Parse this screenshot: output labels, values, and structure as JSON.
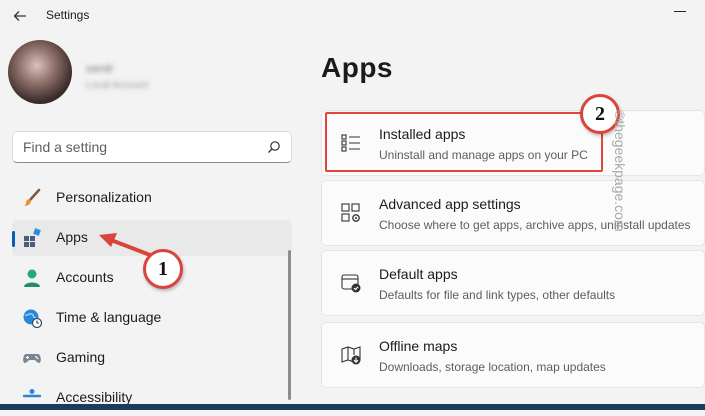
{
  "window": {
    "title": "Settings"
  },
  "profile": {
    "name": "sandr",
    "email": "Local Account"
  },
  "search": {
    "placeholder": "Find a setting"
  },
  "nav": {
    "items": [
      {
        "label": "Personalization",
        "selected": false
      },
      {
        "label": "Apps",
        "selected": true
      },
      {
        "label": "Accounts",
        "selected": false
      },
      {
        "label": "Time & language",
        "selected": false
      },
      {
        "label": "Gaming",
        "selected": false
      },
      {
        "label": "Accessibility",
        "selected": false
      }
    ]
  },
  "main": {
    "title": "Apps",
    "cards": [
      {
        "title": "Installed apps",
        "subtitle": "Uninstall and manage apps on your PC",
        "icon": "list-icon"
      },
      {
        "title": "Advanced app settings",
        "subtitle": "Choose where to get apps, archive apps, uninstall updates",
        "icon": "app-settings-icon"
      },
      {
        "title": "Default apps",
        "subtitle": "Defaults for file and link types, other defaults",
        "icon": "default-apps-icon"
      },
      {
        "title": "Offline maps",
        "subtitle": "Downloads, storage location, map updates",
        "icon": "map-icon"
      }
    ]
  },
  "annotations": {
    "step1": "1",
    "step2": "2",
    "watermark": "©thegeekpage.com"
  },
  "colors": {
    "accent": "#005fb8",
    "annotation": "#e0453b"
  }
}
